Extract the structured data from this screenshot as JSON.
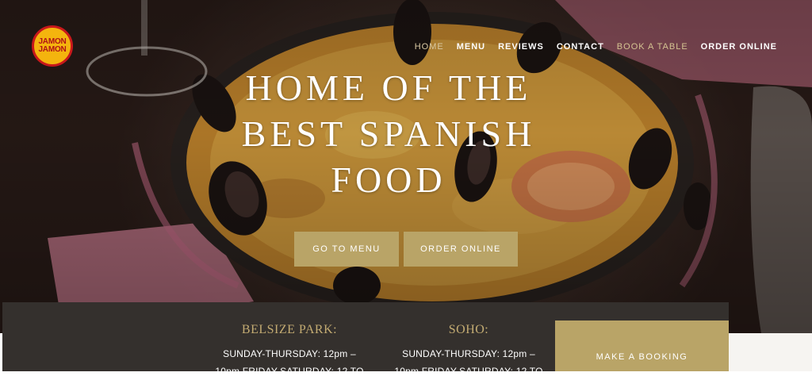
{
  "brand": {
    "logo_line1": "JAMON",
    "logo_line2": "JAMON"
  },
  "nav": {
    "items": [
      {
        "label": "HOME"
      },
      {
        "label": "MENU"
      },
      {
        "label": "REVIEWS"
      },
      {
        "label": "CONTACT"
      },
      {
        "label": "BOOK A TABLE"
      },
      {
        "label": "ORDER ONLINE"
      }
    ]
  },
  "hero": {
    "headline_lines": [
      "HOME OF THE",
      "BEST SPANISH",
      "FOOD"
    ],
    "menu_button": "GO TO MENU",
    "order_button": "ORDER ONLINE"
  },
  "locations": [
    {
      "name": "BELSIZE PARK:",
      "line1": "SUNDAY-THURSDAY: 12pm –",
      "line2": "10pm FRIDAY-SATURDAY: 12 TO"
    },
    {
      "name": "SOHO:",
      "line1": "SUNDAY-THURSDAY: 12pm –",
      "line2": "10pm FRIDAY-SATURDAY: 12 TO"
    }
  ],
  "booking_button": "MAKE A BOOKING",
  "colors": {
    "accent_gold": "#b9a467",
    "info_bar": "#34302d",
    "location_heading": "#c3ab72"
  }
}
